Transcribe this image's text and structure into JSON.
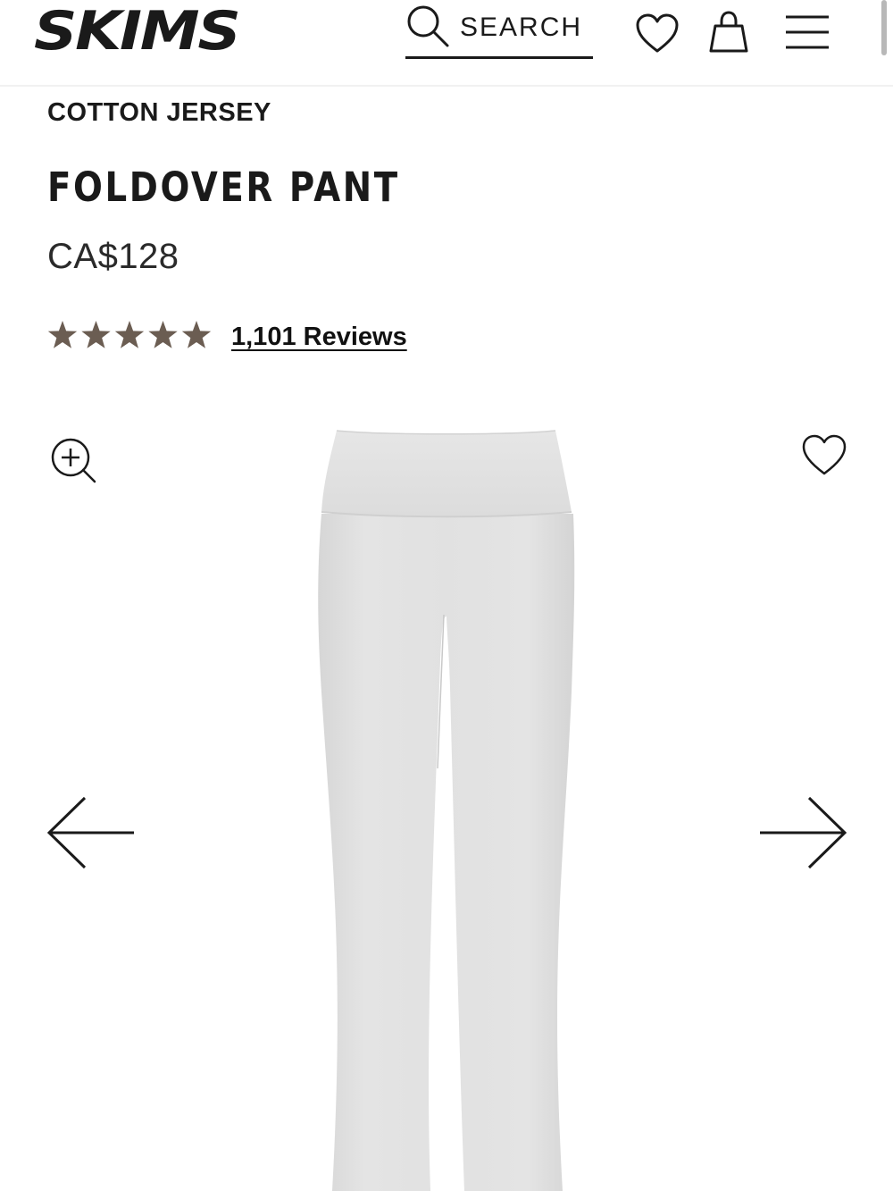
{
  "brand": {
    "logo_text": "SKIMS"
  },
  "header": {
    "search_label": "SEARCH",
    "icons": [
      "search-icon",
      "heart-icon",
      "bag-icon",
      "menu-icon"
    ]
  },
  "product": {
    "collection": "COTTON JERSEY",
    "name": "FOLDOVER PANT",
    "price": "CA$128",
    "rating": 5,
    "rating_max": 5,
    "reviews_label": "1,101 Reviews",
    "image_color": "#e2e2e2"
  },
  "gallery": {
    "icons": [
      "zoom-in-icon",
      "heart-icon",
      "arrow-left-icon",
      "arrow-right-icon"
    ]
  },
  "colors": {
    "text": "#1a1a1a",
    "star": "#6b5d52",
    "fabric": "#e2e2e2"
  }
}
